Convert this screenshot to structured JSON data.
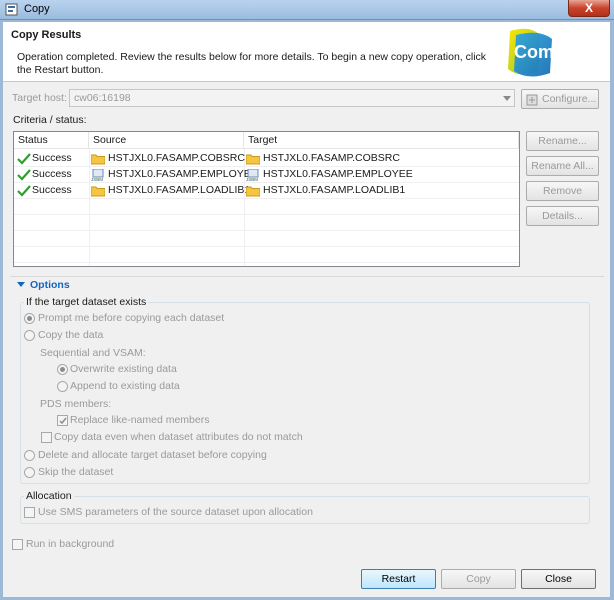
{
  "window": {
    "title": "Copy",
    "close_label": "X"
  },
  "header": {
    "title": "Copy Results",
    "description": "Operation completed. Review the results below for more details. To begin a new copy operation, click the Restart button.",
    "logo_text": "Compuware"
  },
  "target_host": {
    "label": "Target host:",
    "value": "cw06:16198",
    "configure_label": "Configure..."
  },
  "criteria": {
    "label": "Criteria / status:"
  },
  "table": {
    "columns": [
      "Status",
      "Source",
      "Target"
    ],
    "rows": [
      {
        "status": "Success",
        "source": "HSTJXL0.FASAMP.COBSRC",
        "target": "HSTJXL0.FASAMP.COBSRC",
        "icon": "folder-icon"
      },
      {
        "status": "Success",
        "source": "HSTJXL0.FASAMP.EMPLOYEE",
        "target": "HSTJXL0.FASAMP.EMPLOYEE",
        "icon": "jsbm-dataset-icon"
      },
      {
        "status": "Success",
        "source": "HSTJXL0.FASAMP.LOADLIB1",
        "target": "HSTJXL0.FASAMP.LOADLIB1",
        "icon": "folder-icon"
      }
    ]
  },
  "side_buttons": {
    "rename": "Rename...",
    "rename_all": "Rename All...",
    "remove": "Remove",
    "details": "Details..."
  },
  "options": {
    "section_title": "Options",
    "target_exists_group": "If the target dataset exists",
    "prompt": "Prompt me before copying each dataset",
    "copy_data": "Copy the data",
    "seq_vsam_label": "Sequential and VSAM:",
    "overwrite": "Overwrite existing data",
    "append": "Append to existing data",
    "pds_label": "PDS members:",
    "replace_like": "Replace like-named members",
    "copy_even": "Copy data even when dataset attributes do not match",
    "delete_alloc": "Delete and allocate target dataset before copying",
    "skip": "Skip the dataset",
    "allocation_group": "Allocation",
    "use_sms": "Use SMS parameters of the source dataset upon allocation"
  },
  "background": {
    "label": "Run in background"
  },
  "footer": {
    "restart": "Restart",
    "copy": "Copy",
    "close": "Close"
  },
  "colors": {
    "accent": "#1565c0",
    "success": "#2e9e2e",
    "folder": "#f5c542"
  }
}
